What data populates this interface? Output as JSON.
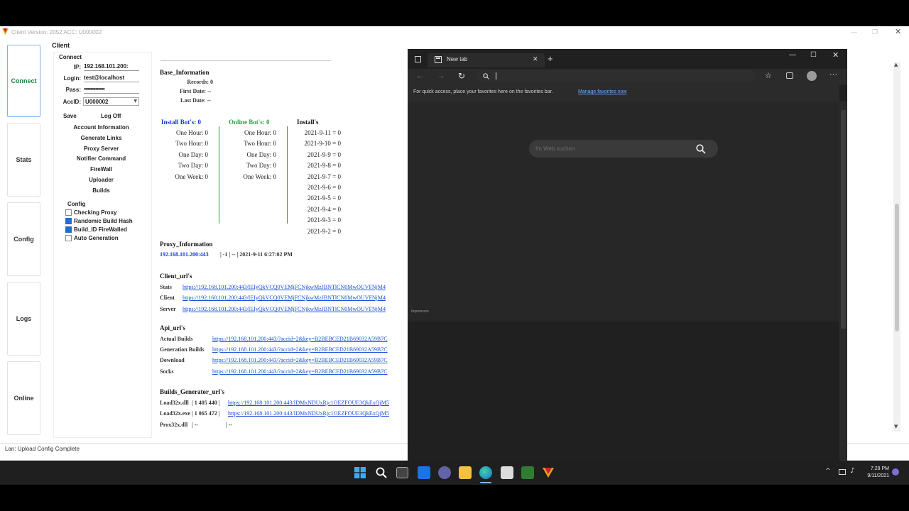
{
  "app": {
    "title": "Client Version: 2052 ACC: U000002",
    "status": "Lan: Upload Config Complete",
    "nav": [
      "Connect",
      "Stats",
      "Config",
      "Logs",
      "Online"
    ],
    "tab": "Client",
    "connect": {
      "heading": "Connect",
      "ip_label": "IP:",
      "ip": "192.168.101.200:",
      "login_label": "Login:",
      "login": "test@localhost",
      "pass_label": "Pass:",
      "pass": "••••••••••••••••",
      "accid_label": "AccID:",
      "accid": "U000002",
      "save": "Save",
      "logoff": "Log Off"
    },
    "buttons": [
      "Account Information",
      "Generate Links",
      "Proxy Server",
      "Notifier Command",
      "FireWall",
      "Uploader",
      "Builds"
    ],
    "config": {
      "heading": "Config",
      "items": [
        {
          "label": "Checking Proxy",
          "checked": false
        },
        {
          "label": "Randomic Build Hash",
          "checked": true
        },
        {
          "label": "Build_ID FireWalled",
          "checked": true
        },
        {
          "label": "Auto Generation",
          "checked": false
        }
      ]
    },
    "base": {
      "heading": "Base_Information",
      "records": "Records: 0",
      "first": "First Date: --",
      "last": "Last Date: --"
    },
    "install_bots": {
      "heading": "Install Bot's: 0",
      "rows": [
        "One Hour: 0",
        "Two Hour: 0",
        "One Day: 0",
        "Two Day: 0",
        "One Week: 0"
      ]
    },
    "online_bots": {
      "heading": "Online Bot's: 0",
      "rows": [
        "One Hour: 0",
        "Two Hour: 0",
        "One Day: 0",
        "Two Day: 0",
        "One Week: 0"
      ]
    },
    "installs": {
      "heading": "Install's",
      "rows": [
        "2021-9-11 = 0",
        "2021-9-10 = 0",
        "2021-9-9 = 0",
        "2021-9-8 = 0",
        "2021-9-7 = 0",
        "2021-9-6 = 0",
        "2021-9-5 = 0",
        "2021-9-4 = 0",
        "2021-9-3 = 0",
        "2021-9-2 = 0"
      ]
    },
    "proxy": {
      "heading": "Proxy_Information",
      "addr": "192.168.101.200:443",
      "rest": "| -1 | -- | 2021-9-11 6:27:02 PM"
    },
    "client_urls": {
      "heading": "Client_url's",
      "rows": [
        {
          "label": "Stats",
          "url": "https://192.168.101.200:443/IEIyQkVCQ0VEMjFCNjkwMzJBNTlCN0MwOUVFNjM4"
        },
        {
          "label": "Client",
          "url": "https://192.168.101.200:443/IEIyQkVCQ0VEMjFCNjkwMzJBNTlCN0MwOUVFNjM4"
        },
        {
          "label": "Server",
          "url": "https://192.168.101.200:443/IEIyQkVCQ0VEMjFCNjkwMzJBNTlCN0MwOUVFNjM4"
        }
      ]
    },
    "api_urls": {
      "heading": "Api_url's",
      "rows": [
        {
          "label": "Actual Builds",
          "url": "https://192.168.101.200:443/?accid=2&key=B2BEBCED21B69032A59B7C"
        },
        {
          "label": "Generation Builds",
          "url": "https://192.168.101.200:443/?accid=2&key=B2BEBCED21B69032A59B7C"
        },
        {
          "label": "Download",
          "url": "https://192.168.101.200:443/?accid=2&key=B2BEBCED21B69032A59B7C"
        },
        {
          "label": "Socks",
          "url": "https://192.168.101.200:443/?accid=2&key=B2BEBCED21B69032A59B7C"
        }
      ]
    },
    "builds_gen": {
      "heading": "Builds_Generator_url's",
      "rows": [
        {
          "label": "Load32x.dll",
          "size": "| 1 405 440 |",
          "url": "https://192.168.101.200:443/IDMxNDUxRjc1OEZFOUE3QkExQjM5"
        },
        {
          "label": "Load32x.exe",
          "size": "| 1 065 472 |",
          "url": "https://192.168.101.200:443/IDMxNDUxRjc1OEZFOUE3QkExQjM5"
        },
        {
          "label": "Prox32x.dll",
          "size": "| --",
          "url": "| --"
        }
      ]
    }
  },
  "edge": {
    "tab_title": "New tab",
    "fav_text": "For quick access, place your favorites here on the favorites bar.",
    "fav_link": "Manage favorites now",
    "search_placeholder": "Im Web suchen",
    "impressum": "Impressum"
  },
  "clock": {
    "time": "7:28 PM",
    "date": "9/11/2021"
  }
}
